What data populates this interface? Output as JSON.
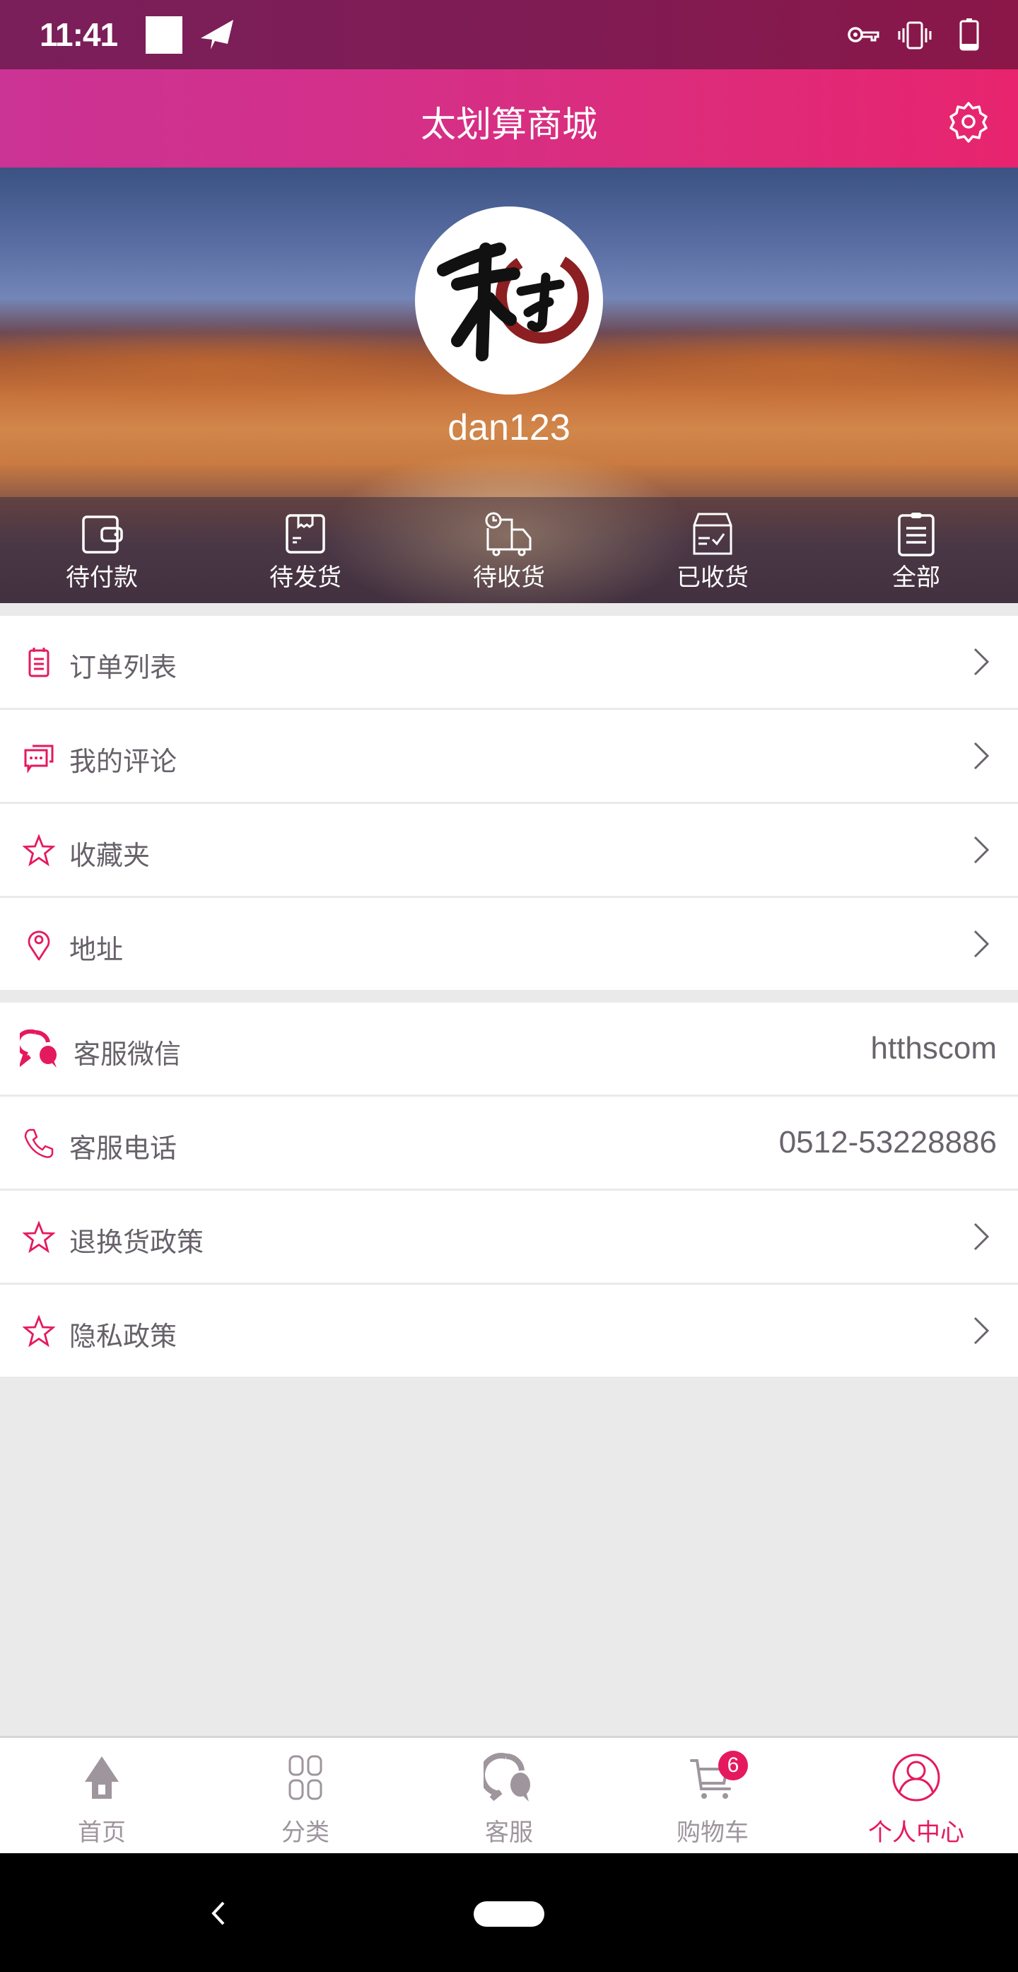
{
  "status_bar": {
    "time": "11:41",
    "icons": [
      "notification-square-icon",
      "send-icon",
      "vpn-key-icon",
      "vibrate-icon",
      "battery-icon"
    ],
    "battery_level": 0.2
  },
  "header": {
    "title": "太划算商城",
    "settings_icon": "gear-icon"
  },
  "profile": {
    "username": "dan123",
    "avatar_text": "禾才"
  },
  "orders": [
    {
      "label": "待付款",
      "icon": "wallet-icon"
    },
    {
      "label": "待发货",
      "icon": "package-icon"
    },
    {
      "label": "待收货",
      "icon": "delivery-truck-icon"
    },
    {
      "label": "已收货",
      "icon": "received-box-icon"
    },
    {
      "label": "全部",
      "icon": "clipboard-icon"
    }
  ],
  "menu_group_1": [
    {
      "label": "订单列表",
      "icon": "order-list-icon"
    },
    {
      "label": "我的评论",
      "icon": "comment-icon"
    },
    {
      "label": "收藏夹",
      "icon": "star-icon"
    },
    {
      "label": "地址",
      "icon": "location-pin-icon"
    }
  ],
  "menu_group_2": [
    {
      "label": "客服微信",
      "icon": "chat-bubbles-icon",
      "value": "htthscom"
    },
    {
      "label": "客服电话",
      "icon": "phone-icon",
      "value": "0512-53228886"
    },
    {
      "label": "退换货政策",
      "icon": "star-icon"
    },
    {
      "label": "隐私政策",
      "icon": "star-icon"
    }
  ],
  "bottom_nav": [
    {
      "label": "首页",
      "icon": "home-icon",
      "active": false
    },
    {
      "label": "分类",
      "icon": "category-grid-icon",
      "active": false
    },
    {
      "label": "客服",
      "icon": "customer-service-icon",
      "active": false
    },
    {
      "label": "购物车",
      "icon": "cart-icon",
      "active": false,
      "badge": "6"
    },
    {
      "label": "个人中心",
      "icon": "user-icon",
      "active": true
    }
  ],
  "colors": {
    "accent": "#e5195e",
    "header_start": "#cb3394",
    "header_end": "#e8246e",
    "status_bar": "#7f1c55",
    "text": "#67616a",
    "nav_inactive": "#9e959d",
    "background": "#eaeaea"
  }
}
